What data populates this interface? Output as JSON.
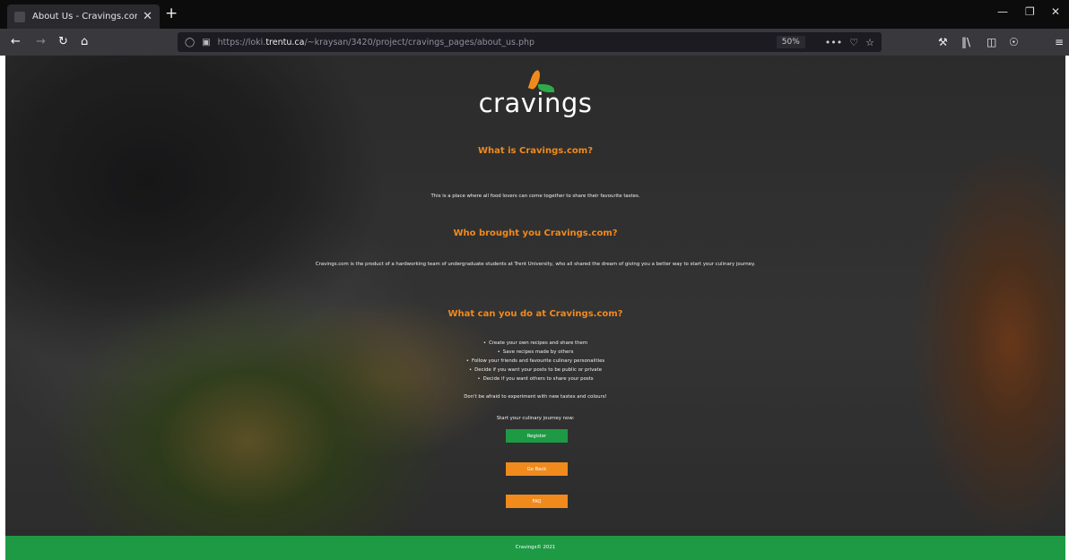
{
  "browser": {
    "tab_title": "About Us - Cravings.com",
    "tab_close": "✕",
    "new_tab": "+",
    "url_prefix": "https://loki.",
    "url_domain": "trentu.ca",
    "url_path": "/~kraysan/3420/project/cravings_pages/about_us.php",
    "zoom": "50%",
    "more": "•••",
    "icons": [
      "back-icon",
      "forward-icon",
      "reload-icon",
      "home-icon",
      "shield-icon",
      "lock-icon",
      "pocket-icon",
      "bookmark-star-icon",
      "wrench-icon",
      "library-icon",
      "sidebar-icon",
      "account-icon",
      "menu-icon"
    ]
  },
  "page": {
    "logo_text": "cravings",
    "sections": [
      {
        "heading": "What is Cravings.com?",
        "text": "This is a place where all food lovers can come together to share their favourite tastes."
      },
      {
        "heading": "Who brought you Cravings.com?",
        "text": "Cravings.com is the product of a hardworking team of undergraduate students at Trent University, who all shared the dream of giving you a better way to start your culinary journey."
      },
      {
        "heading": "What can you do at Cravings.com?",
        "bullets": [
          "Create your own recipes and share them",
          "Save recipes made by others",
          "Follow your friends and favourite culinary personalities",
          "Decide if you want your posts to be public or private",
          "Decide if you want others to share your posts"
        ]
      }
    ],
    "tagline": "Don't be afraid to experiment with new tastes and colours!",
    "cta_text": "Start your culinary journey now:",
    "buttons": {
      "register": "Register",
      "go_back": "Go Back",
      "faq": "FAQ"
    },
    "footer": "Cravings© 2021"
  },
  "colors": {
    "accent_orange": "#f08a1d",
    "accent_green": "#1e9a45"
  }
}
